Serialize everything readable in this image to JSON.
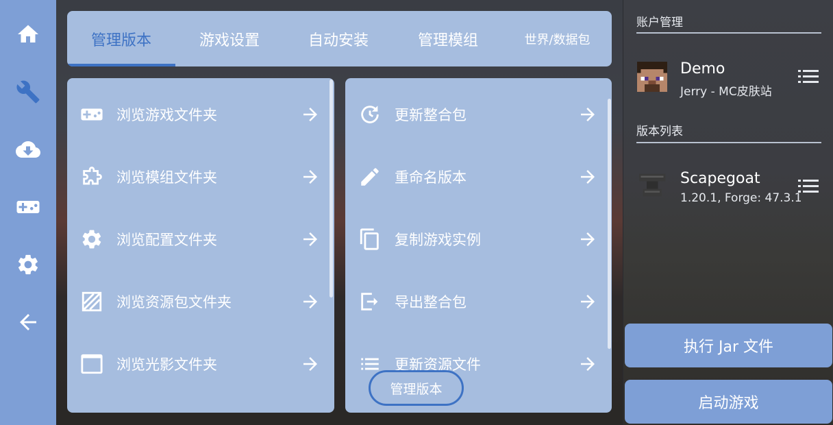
{
  "nav": {
    "items": [
      {
        "icon": "home-icon"
      },
      {
        "icon": "wrench-icon"
      },
      {
        "icon": "cloud-download-icon"
      },
      {
        "icon": "gamepad-icon"
      },
      {
        "icon": "gear-icon"
      },
      {
        "icon": "back-arrow-icon"
      }
    ]
  },
  "tabs": [
    {
      "label": "管理版本",
      "active": true
    },
    {
      "label": "游戏设置"
    },
    {
      "label": "自动安装"
    },
    {
      "label": "管理模组"
    },
    {
      "label": "世界/数据包"
    }
  ],
  "left_panel": {
    "items": [
      {
        "icon": "gamepad-icon",
        "label": "浏览游戏文件夹"
      },
      {
        "icon": "puzzle-icon",
        "label": "浏览模组文件夹"
      },
      {
        "icon": "gear-icon",
        "label": "浏览配置文件夹"
      },
      {
        "icon": "texture-icon",
        "label": "浏览资源包文件夹"
      },
      {
        "icon": "window-icon",
        "label": "浏览光影文件夹"
      }
    ]
  },
  "right_panel": {
    "items": [
      {
        "icon": "update-icon",
        "label": "更新整合包"
      },
      {
        "icon": "pencil-icon",
        "label": "重命名版本"
      },
      {
        "icon": "copy-icon",
        "label": "复制游戏实例"
      },
      {
        "icon": "export-icon",
        "label": "导出整合包"
      },
      {
        "icon": "list-icon",
        "label": "更新资源文件"
      }
    ]
  },
  "tooltip": "管理版本",
  "sidebar": {
    "account_title": "账户管理",
    "account": {
      "name": "Demo",
      "sub": "Jerry - MC皮肤站"
    },
    "versions_title": "版本列表",
    "version": {
      "name": "Scapegoat",
      "sub": "1.20.1, Forge: 47.3.1"
    },
    "run_jar": "执行 Jar 文件",
    "launch": "启动游戏"
  },
  "colors": {
    "accent": "#3d72c4",
    "nav_bg": "#7e9fd6",
    "panel_bg": "#a6bddf"
  }
}
